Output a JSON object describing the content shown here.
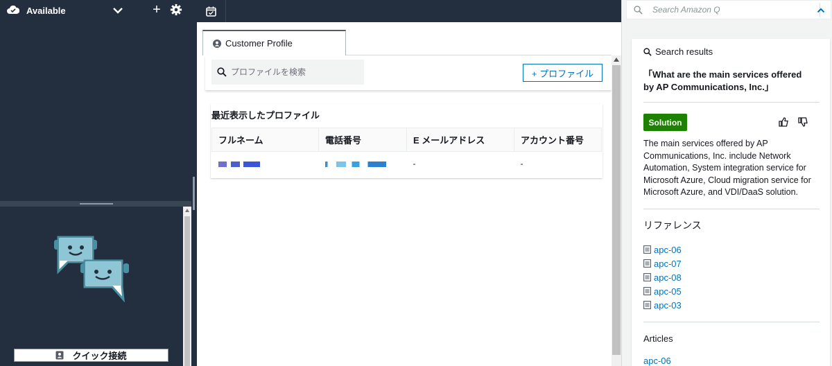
{
  "agent_status": {
    "label": "Available"
  },
  "quick_connect": {
    "label": "クイック接続"
  },
  "customer_profile": {
    "tab_label": "Customer Profile",
    "search_placeholder": "プロファイルを検索",
    "add_button_label": "+ プロファイル",
    "recent_title": "最近表示したプロファイル",
    "columns": [
      "フルネーム",
      "電話番号",
      "E メールアドレス",
      "アカウント番号"
    ],
    "rows": [
      {
        "email": "-",
        "account": "-"
      }
    ]
  },
  "amazon_q": {
    "search_placeholder": "Search Amazon Q",
    "results_header": "Search results",
    "query": "「What are the main services offered by AP Communications, Inc.」",
    "badge": "Solution",
    "answer": "The main services offered by AP Communications, Inc. include Network Automation, System integration service for Microsoft Azure, Cloud migration service for Microsoft Azure, and VDI/DaaS solution.",
    "references_title": "リファレンス",
    "references": [
      "apc-06",
      "apc-07",
      "apc-08",
      "apc-05",
      "apc-03"
    ],
    "articles_title": "Articles",
    "articles": [
      "apc-06"
    ]
  },
  "colors": {
    "nav_dark": "#232f3e",
    "link_blue": "#0073bb",
    "solution_green": "#1d8102"
  },
  "icons": [
    "cloud-check-icon",
    "chevron-down-icon",
    "plus-icon",
    "gear-icon",
    "calendar-icon",
    "user-circle-icon",
    "search-icon",
    "chevron-up-icon",
    "thumbs-up-icon",
    "thumbs-down-icon",
    "document-icon",
    "contact-card-icon",
    "chat-bots-illustration"
  ]
}
